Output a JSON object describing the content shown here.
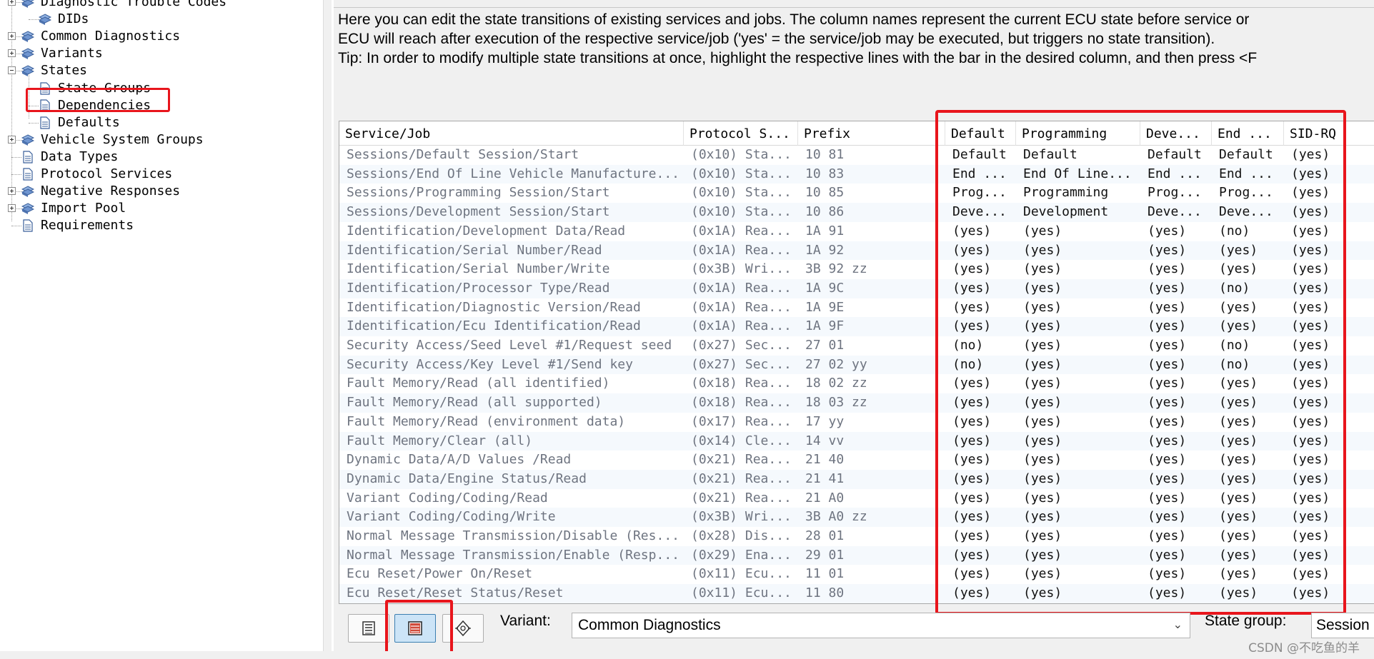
{
  "tree": {
    "items": [
      {
        "label": "Diagnostic Trouble Codes",
        "level": 0,
        "expander": "plus",
        "icon": "folder-group-icon"
      },
      {
        "label": "DIDs",
        "level": 1,
        "expander": "",
        "icon": "folder-group-icon"
      },
      {
        "label": "Common Diagnostics",
        "level": 0,
        "expander": "plus",
        "icon": "folder-group-icon"
      },
      {
        "label": "Variants",
        "level": 0,
        "expander": "plus",
        "icon": "folder-group-icon"
      },
      {
        "label": "States",
        "level": 0,
        "expander": "minus",
        "icon": "folder-group-icon"
      },
      {
        "label": "State Groups",
        "level": 1,
        "expander": "",
        "icon": "document-icon"
      },
      {
        "label": "Dependencies",
        "level": 1,
        "expander": "",
        "icon": "document-icon"
      },
      {
        "label": "Defaults",
        "level": 1,
        "expander": "",
        "icon": "document-icon"
      },
      {
        "label": "Vehicle System Groups",
        "level": 0,
        "expander": "plus",
        "icon": "folder-group-icon"
      },
      {
        "label": "Data Types",
        "level": 0,
        "expander": "",
        "icon": "document-icon"
      },
      {
        "label": "Protocol Services",
        "level": 0,
        "expander": "",
        "icon": "document-icon"
      },
      {
        "label": "Negative Responses",
        "level": 0,
        "expander": "plus",
        "icon": "folder-group-icon"
      },
      {
        "label": "Import Pool",
        "level": 0,
        "expander": "plus",
        "icon": "folder-group-icon"
      },
      {
        "label": "Requirements",
        "level": 0,
        "expander": "",
        "icon": "document-icon"
      }
    ]
  },
  "description": {
    "line1": "Here you can edit the state transitions of existing services and jobs. The column names represent the current ECU state before service or",
    "line2": "ECU will reach after execution of the respective service/job ('yes' = the service/job may be executed, but triggers no state transition).",
    "line3": "Tip: In order to modify multiple state transitions at once, highlight the respective lines with the bar in the desired column, and then press <F"
  },
  "table": {
    "columns": [
      "Service/Job",
      "Protocol S...",
      "Prefix",
      "Default",
      "Programming",
      "Deve...",
      "End ...",
      "SID-RQ"
    ],
    "rows": [
      [
        "Sessions/Default Session/Start",
        "(0x10) Sta...",
        "10 81",
        "Default",
        "Default",
        "Default",
        "Default",
        "(yes)"
      ],
      [
        "Sessions/End Of Line Vehicle Manufacture...",
        "(0x10) Sta...",
        "10 83",
        "End ...",
        "End Of Line...",
        "End ...",
        "End ...",
        "(yes)"
      ],
      [
        "Sessions/Programming Session/Start",
        "(0x10) Sta...",
        "10 85",
        "Prog...",
        "Programming",
        "Prog...",
        "Prog...",
        "(yes)"
      ],
      [
        "Sessions/Development Session/Start",
        "(0x10) Sta...",
        "10 86",
        "Deve...",
        "Development",
        "Deve...",
        "Deve...",
        "(yes)"
      ],
      [
        "Identification/Development Data/Read",
        "(0x1A) Rea...",
        "1A 91",
        "(yes)",
        "(yes)",
        "(yes)",
        "(no)",
        "(yes)"
      ],
      [
        "Identification/Serial Number/Read",
        "(0x1A) Rea...",
        "1A 92",
        "(yes)",
        "(yes)",
        "(yes)",
        "(yes)",
        "(yes)"
      ],
      [
        "Identification/Serial Number/Write",
        "(0x3B) Wri...",
        "3B 92 zz",
        "(yes)",
        "(yes)",
        "(yes)",
        "(yes)",
        "(yes)"
      ],
      [
        "Identification/Processor Type/Read",
        "(0x1A) Rea...",
        "1A 9C",
        "(yes)",
        "(yes)",
        "(yes)",
        "(no)",
        "(yes)"
      ],
      [
        "Identification/Diagnostic Version/Read",
        "(0x1A) Rea...",
        "1A 9E",
        "(yes)",
        "(yes)",
        "(yes)",
        "(yes)",
        "(yes)"
      ],
      [
        "Identification/Ecu Identification/Read",
        "(0x1A) Rea...",
        "1A 9F",
        "(yes)",
        "(yes)",
        "(yes)",
        "(yes)",
        "(yes)"
      ],
      [
        "Security Access/Seed Level #1/Request seed",
        "(0x27) Sec...",
        "27 01",
        "(no)",
        "(yes)",
        "(yes)",
        "(no)",
        "(yes)"
      ],
      [
        "Security Access/Key Level #1/Send key",
        "(0x27) Sec...",
        "27 02 yy",
        "(no)",
        "(yes)",
        "(yes)",
        "(no)",
        "(yes)"
      ],
      [
        "Fault Memory/Read (all identified)",
        "(0x18) Rea...",
        "18 02 zz",
        "(yes)",
        "(yes)",
        "(yes)",
        "(yes)",
        "(yes)"
      ],
      [
        "Fault Memory/Read (all supported)",
        "(0x18) Rea...",
        "18 03 zz",
        "(yes)",
        "(yes)",
        "(yes)",
        "(yes)",
        "(yes)"
      ],
      [
        "Fault Memory/Read (environment data)",
        "(0x17) Rea...",
        "17 yy",
        "(yes)",
        "(yes)",
        "(yes)",
        "(yes)",
        "(yes)"
      ],
      [
        "Fault Memory/Clear (all)",
        "(0x14) Cle...",
        "14 vv",
        "(yes)",
        "(yes)",
        "(yes)",
        "(yes)",
        "(yes)"
      ],
      [
        "Dynamic Data/A/D Values /Read",
        "(0x21) Rea...",
        "21 40",
        "(yes)",
        "(yes)",
        "(yes)",
        "(yes)",
        "(yes)"
      ],
      [
        "Dynamic Data/Engine Status/Read",
        "(0x21) Rea...",
        "21 41",
        "(yes)",
        "(yes)",
        "(yes)",
        "(yes)",
        "(yes)"
      ],
      [
        "Variant Coding/Coding/Read",
        "(0x21) Rea...",
        "21 A0",
        "(yes)",
        "(yes)",
        "(yes)",
        "(yes)",
        "(yes)"
      ],
      [
        "Variant Coding/Coding/Write",
        "(0x3B) Wri...",
        "3B A0 zz",
        "(yes)",
        "(yes)",
        "(yes)",
        "(yes)",
        "(yes)"
      ],
      [
        "Normal Message Transmission/Disable (Res...",
        "(0x28) Dis...",
        "28 01",
        "(yes)",
        "(yes)",
        "(yes)",
        "(yes)",
        "(yes)"
      ],
      [
        "Normal Message Transmission/Enable (Resp...",
        "(0x29) Ena...",
        "29 01",
        "(yes)",
        "(yes)",
        "(yes)",
        "(yes)",
        "(yes)"
      ],
      [
        "Ecu Reset/Power On/Reset",
        "(0x11) Ecu...",
        "11 01",
        "(yes)",
        "(yes)",
        "(yes)",
        "(yes)",
        "(yes)"
      ],
      [
        "Ecu Reset/Reset Status/Reset",
        "(0x11) Ecu...",
        "11 80",
        "(yes)",
        "(yes)",
        "(yes)",
        "(yes)",
        "(yes)"
      ]
    ]
  },
  "bottom": {
    "variant_label": "Variant:",
    "variant_value": "Common Diagnostics",
    "state_group_label": "State group:",
    "state_group_value": "Session",
    "buttons": [
      {
        "icon": "list-view-icon",
        "active": false
      },
      {
        "icon": "state-table-icon",
        "active": true
      },
      {
        "icon": "transition-diagram-icon",
        "active": false
      }
    ]
  },
  "watermark": "CSDN @不吃鱼的羊",
  "colors": {
    "highlight": "#e8151c",
    "grey_text": "#6e7480",
    "panel_bg": "#f0f0f0",
    "active_button": "#cce4f7"
  }
}
